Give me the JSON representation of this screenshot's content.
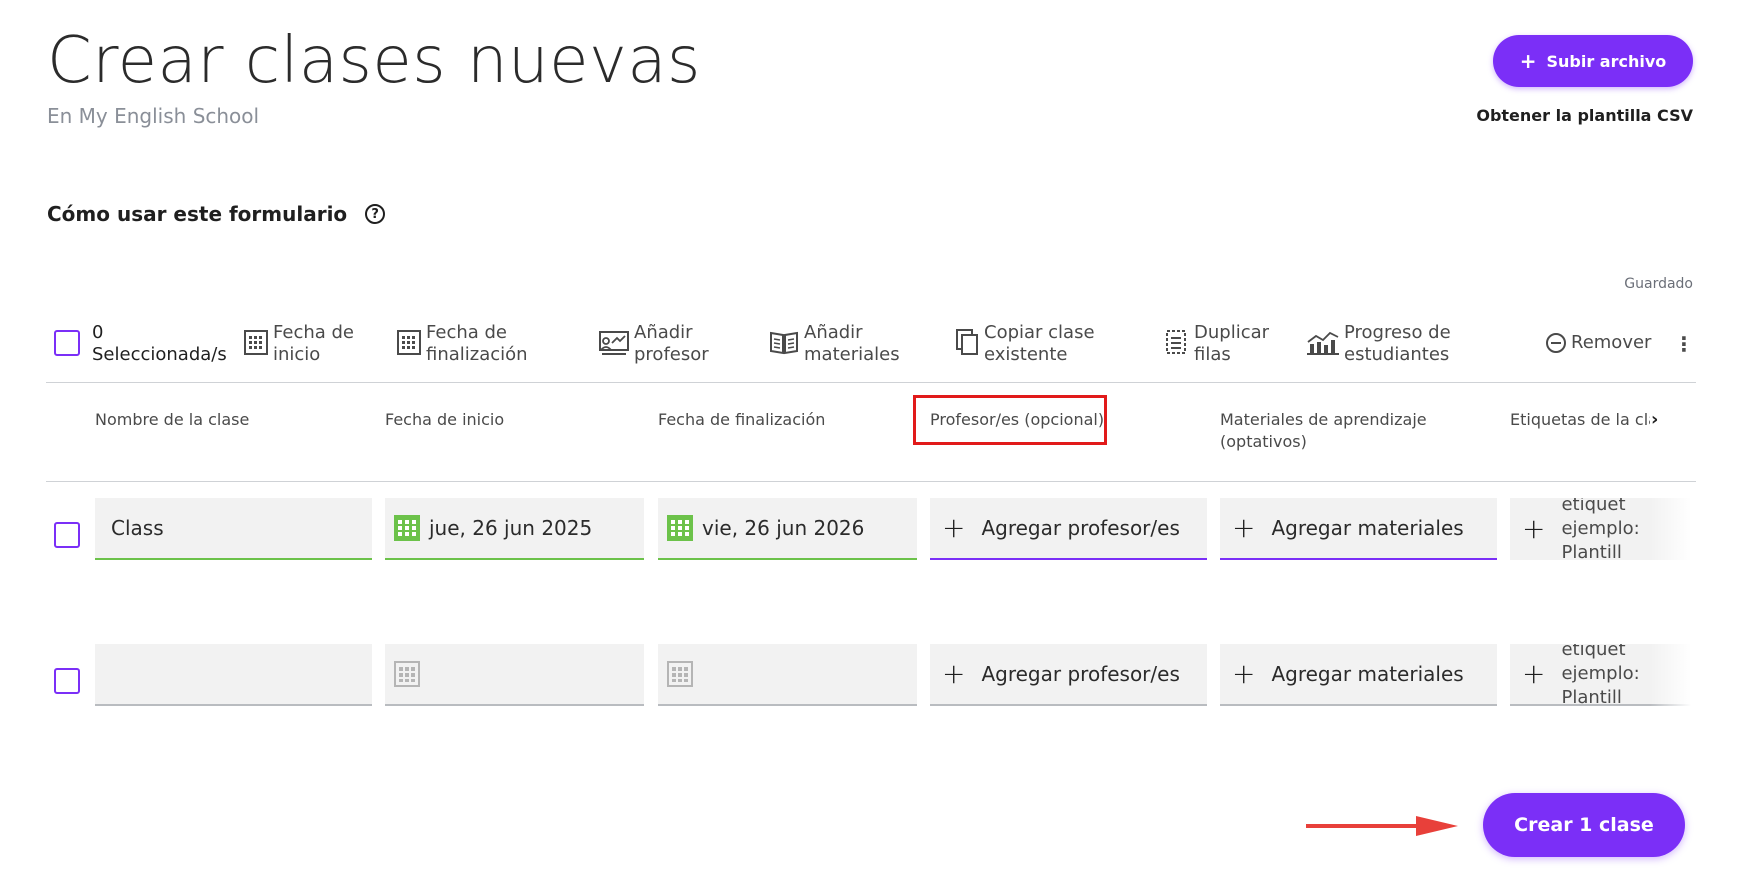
{
  "page": {
    "title": "Crear clases nuevas",
    "subtitle": "En My English School",
    "upload_button": "Subir archivo",
    "csv_link": "Obtener la plantilla CSV",
    "howto_label": "Cómo usar este formulario",
    "help_glyph": "?",
    "saved_status": "Guardado"
  },
  "toolbar": {
    "selected": "0\nSeleccionada/s",
    "items": [
      {
        "label": "Fecha de\ninicio",
        "icon": "calendar-icon"
      },
      {
        "label": "Fecha de\nfinalización",
        "icon": "calendar-icon"
      },
      {
        "label": "Añadir\nprofesor",
        "icon": "teacher-board-icon"
      },
      {
        "label": "Añadir\nmateriales",
        "icon": "open-book-icon"
      },
      {
        "label": "Copiar clase\nexistente",
        "icon": "copy-icon"
      },
      {
        "label": "Duplicar\nfilas",
        "icon": "duplicate-rows-icon"
      },
      {
        "label": "Progreso de\nestudiantes",
        "icon": "progress-chart-icon"
      },
      {
        "label": "Remover",
        "icon": "minus-circle-icon"
      }
    ],
    "kebab": "⋮"
  },
  "columns": [
    "Nombre de la clase",
    "Fecha de inicio",
    "Fecha de finalización",
    "Profesor/es (opcional)",
    "Materiales de aprendizaje\n(optativos)",
    "Etiquetas de la clase (O"
  ],
  "rows": [
    {
      "name": "Class",
      "start": "jue, 26 jun 2025",
      "end": "vie, 26 jun 2026",
      "teachers": "Agregar profesor/es",
      "materials": "Agregar materiales",
      "tags": "Agregar etiquet\nejemplo: Plantill\nclase)"
    },
    {
      "name": "",
      "start": "",
      "end": "",
      "teachers": "Agregar profesor/es",
      "materials": "Agregar materiales",
      "tags": "Agregar etiquet\nejemplo: Plantill\nclase)"
    }
  ],
  "create_button": "Crear 1 clase",
  "colors": {
    "accent": "#7b2ff7",
    "valid": "#6cc24a",
    "highlight": "#e11a1a",
    "arrow": "#e8403a"
  }
}
